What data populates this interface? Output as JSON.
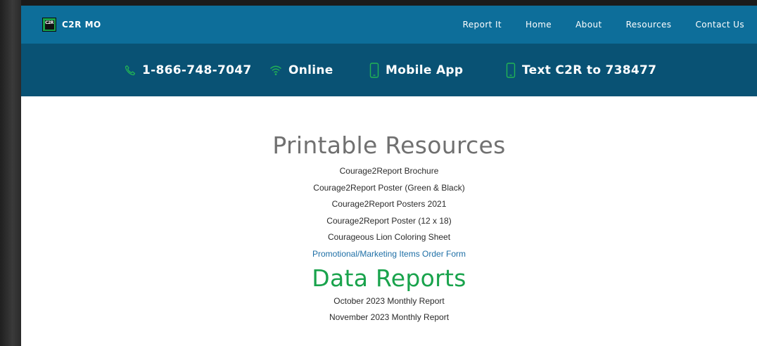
{
  "header": {
    "logo_text": "C2R",
    "brand": "C2R MO",
    "nav": [
      "Report It",
      "Home",
      "About",
      "Resources",
      "Contact Us"
    ]
  },
  "contact_bar": {
    "phone": "1-866-748-7047",
    "online": "Online",
    "mobile_app": "Mobile App",
    "text": "Text C2R to 738477"
  },
  "printable": {
    "title": "Printable Resources",
    "items": [
      "Courage2Report Brochure",
      "Courage2Report Poster (Green & Black)",
      "Courage2Report Posters 2021",
      "Courage2Report Poster (12 x 18)",
      "Courageous Lion Coloring Sheet",
      "Promotional/Marketing Items Order Form"
    ]
  },
  "data_reports": {
    "title": "Data Reports",
    "items": [
      "October 2023 Monthly Report",
      "November 2023 Monthly Report"
    ]
  },
  "icons": {
    "phone": "phone-icon",
    "online": "wifi-icon",
    "mobile": "mobile-phone-icon",
    "text": "mobile-phone-icon"
  },
  "colors": {
    "nav_bg": "#0d6e9a",
    "contact_bg": "#095274",
    "accent_green": "#19a34c",
    "link_blue": "#1e6fa6",
    "heading_gray": "#707070"
  }
}
